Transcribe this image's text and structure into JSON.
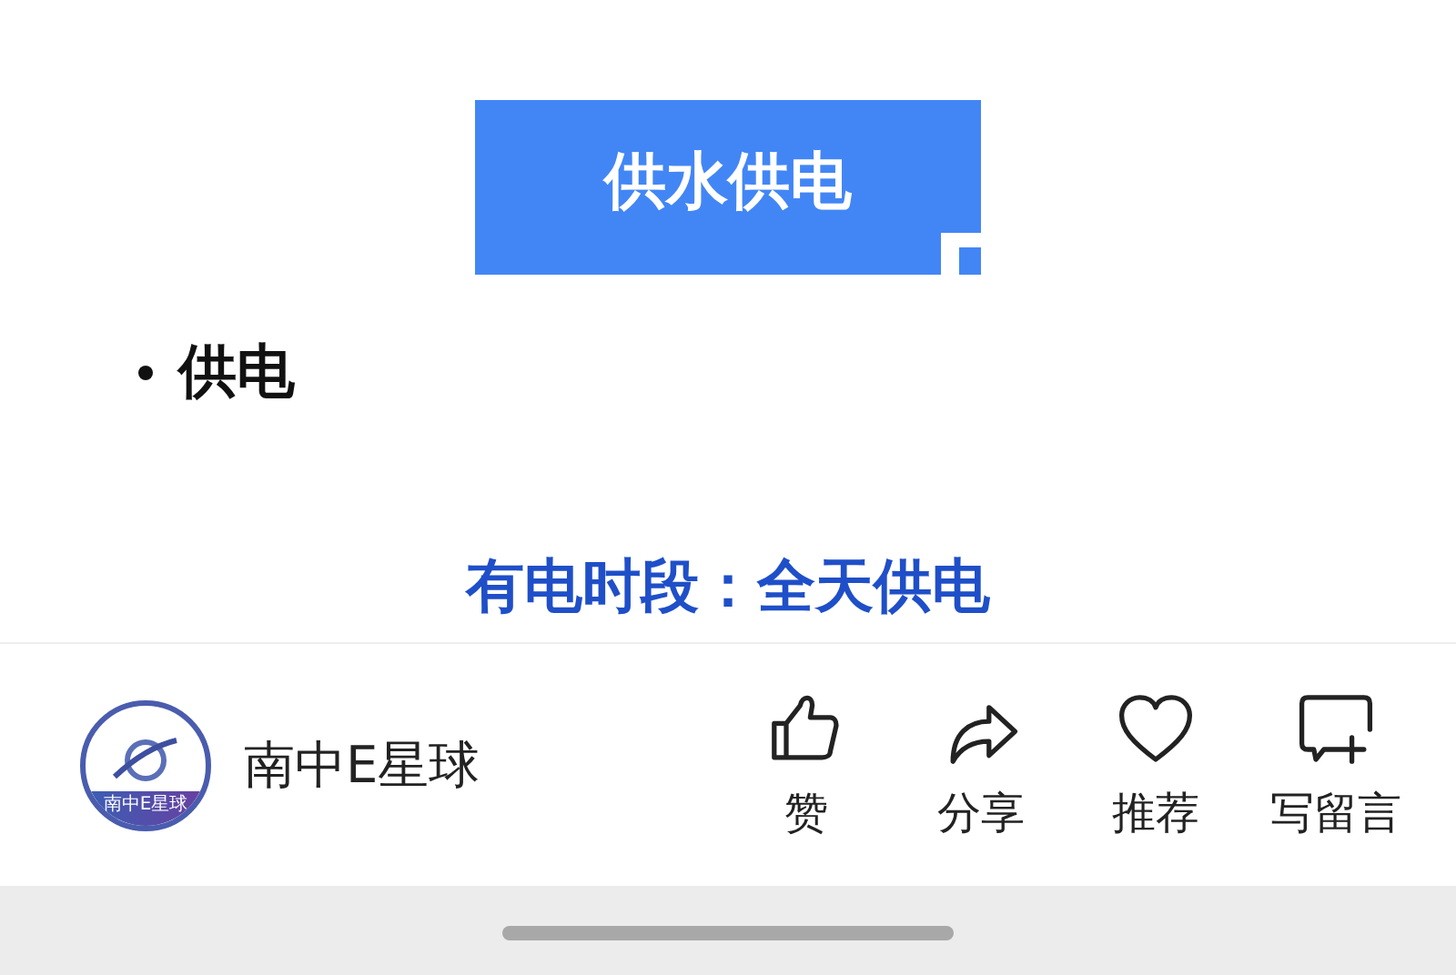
{
  "article": {
    "heading": "供水供电",
    "bullets": [
      "供电"
    ],
    "notice": "有电时段：全天供电"
  },
  "footer": {
    "account": {
      "logo_text": "南中E星球",
      "name": "南中E星球"
    },
    "actions": [
      {
        "kind": "like",
        "label": "赞"
      },
      {
        "kind": "share",
        "label": "分享"
      },
      {
        "kind": "recommend",
        "label": "推荐"
      },
      {
        "kind": "comment",
        "label": "写留言"
      }
    ]
  }
}
